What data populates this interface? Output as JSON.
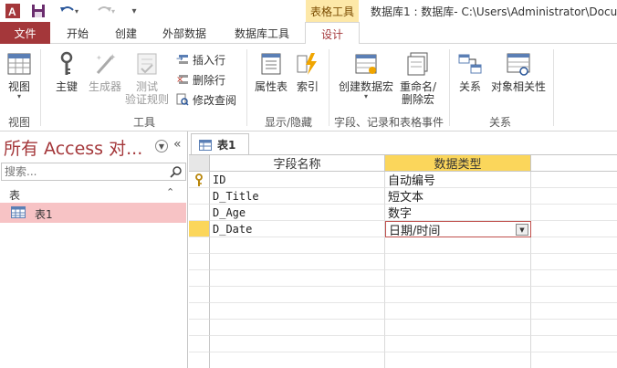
{
  "titlebar": {
    "context_tab_label": "表格工具",
    "window_title": "数据库1 : 数据库- C:\\Users\\Administrator\\Docu"
  },
  "tabs": {
    "file": "文件",
    "home": "开始",
    "create": "创建",
    "external": "外部数据",
    "dbtools": "数据库工具",
    "design": "设计"
  },
  "ribbon": {
    "view": "视图",
    "primary_key": "主键",
    "builder": "生成器",
    "test_line1": "测试",
    "test_line2": "验证规则",
    "insert_row": "插入行",
    "delete_row": "删除行",
    "modify_lookup": "修改查阅",
    "property_sheet": "属性表",
    "indexes": "索引",
    "create_macro": "创建数据宏",
    "rename_line1": "重命名/",
    "rename_line2": "删除宏",
    "relationships": "关系",
    "object_deps": "对象相关性",
    "groups": {
      "views": "视图",
      "tools": "工具",
      "show_hide": "显示/隐藏",
      "field_events": "字段、记录和表格事件",
      "relationships": "关系"
    }
  },
  "nav": {
    "title": "所有 Access 对...",
    "search_placeholder": "搜索...",
    "group_label": "表",
    "items": [
      {
        "label": "表1"
      }
    ]
  },
  "doc": {
    "tab_label": "表1",
    "columns": {
      "field_name": "字段名称",
      "data_type": "数据类型"
    },
    "rows": [
      {
        "name": "ID",
        "type": "自动编号"
      },
      {
        "name": "D_Title",
        "type": "短文本"
      },
      {
        "name": "D_Age",
        "type": "数字"
      },
      {
        "name": "D_Date",
        "type": "日期/时间"
      }
    ]
  },
  "colors": {
    "accent": "#a4373a",
    "context": "#fde8a8",
    "highlight": "#fbd65b",
    "nav_selected": "#f7c3c5"
  }
}
